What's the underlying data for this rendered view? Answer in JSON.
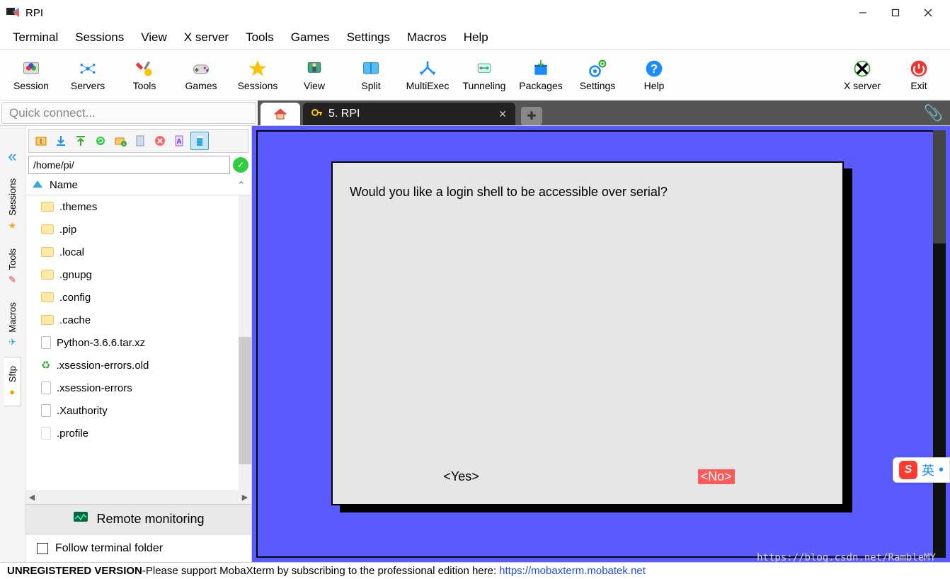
{
  "window": {
    "title": "RPI"
  },
  "menubar": [
    "Terminal",
    "Sessions",
    "View",
    "X server",
    "Tools",
    "Games",
    "Settings",
    "Macros",
    "Help"
  ],
  "toolbar": [
    {
      "label": "Session",
      "icon": "session"
    },
    {
      "label": "Servers",
      "icon": "servers"
    },
    {
      "label": "Tools",
      "icon": "tools"
    },
    {
      "label": "Games",
      "icon": "games"
    },
    {
      "label": "Sessions",
      "icon": "sessions"
    },
    {
      "label": "View",
      "icon": "view"
    },
    {
      "label": "Split",
      "icon": "split"
    },
    {
      "label": "MultiExec",
      "icon": "multiexec"
    },
    {
      "label": "Tunneling",
      "icon": "tunneling"
    },
    {
      "label": "Packages",
      "icon": "packages"
    },
    {
      "label": "Settings",
      "icon": "settings"
    },
    {
      "label": "Help",
      "icon": "help"
    }
  ],
  "toolbar_right": [
    {
      "label": "X server",
      "icon": "xserver"
    },
    {
      "label": "Exit",
      "icon": "exit"
    }
  ],
  "quick_connect_placeholder": "Quick connect...",
  "tabs": {
    "active_label": "5. RPI"
  },
  "vtabs": [
    "Sessions",
    "Tools",
    "Macros",
    "Sftp"
  ],
  "filepanel": {
    "path": "/home/pi/",
    "header": "Name",
    "items": [
      {
        "name": ".themes",
        "type": "folder"
      },
      {
        "name": ".pip",
        "type": "folder"
      },
      {
        "name": ".local",
        "type": "folder"
      },
      {
        "name": ".gnupg",
        "type": "folder"
      },
      {
        "name": ".config",
        "type": "folder"
      },
      {
        "name": ".cache",
        "type": "folder"
      },
      {
        "name": "Python-3.6.6.tar.xz",
        "type": "file"
      },
      {
        "name": ".xsession-errors.old",
        "type": "recycle"
      },
      {
        "name": ".xsession-errors",
        "type": "file"
      },
      {
        "name": ".Xauthority",
        "type": "file"
      },
      {
        "name": ".profile",
        "type": "file-dim"
      }
    ],
    "remote_monitoring": "Remote monitoring",
    "follow_label": "Follow terminal folder"
  },
  "dialog": {
    "question": "Would you like a login shell to be accessible over serial?",
    "yes": "<Yes>",
    "no": "<No>"
  },
  "ime": {
    "label": "英"
  },
  "status": {
    "unreg": "UNREGISTERED VERSION",
    "sep": "  -  ",
    "msg": "Please support MobaXterm by subscribing to the professional edition here:",
    "url": "https://mobaxterm.mobatek.net"
  },
  "watermark": "https://blog.csdn.net/RambleMY"
}
